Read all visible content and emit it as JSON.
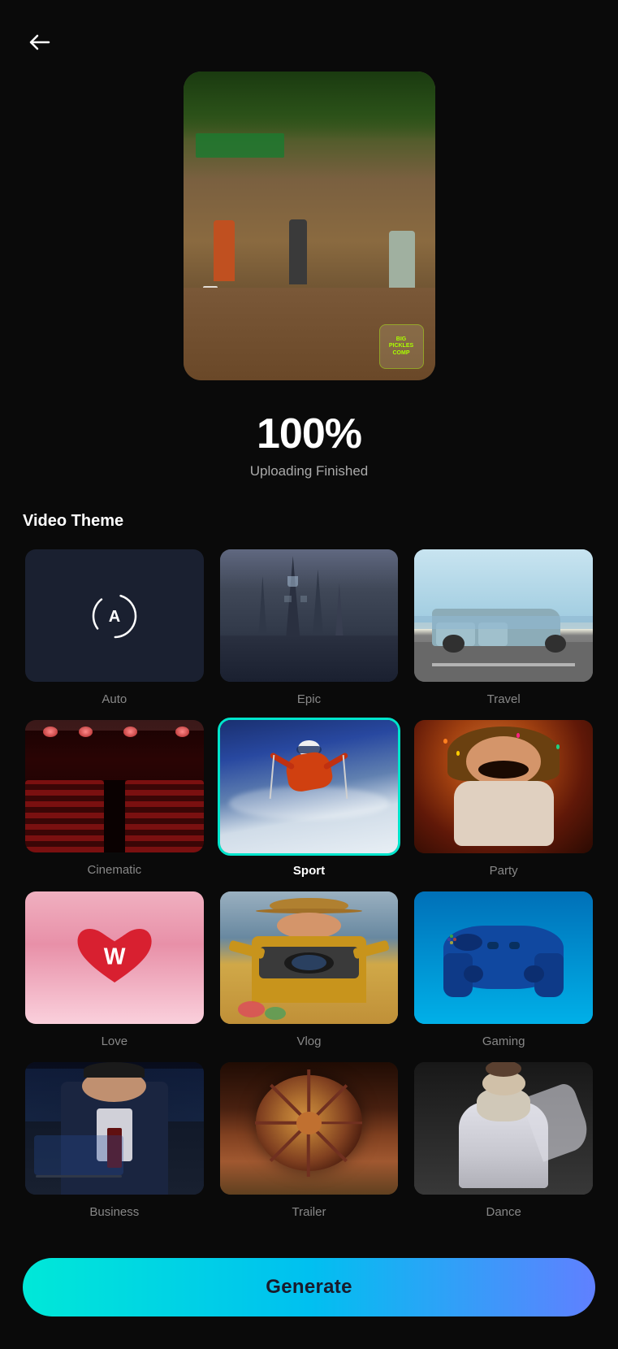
{
  "header": {
    "back_label": "←"
  },
  "upload": {
    "progress": "100%",
    "status": "Uploading Finished"
  },
  "theme_section": {
    "title": "Video Theme",
    "selected": "Sport",
    "themes": [
      {
        "id": "auto",
        "label": "Auto",
        "type": "auto"
      },
      {
        "id": "epic",
        "label": "Epic",
        "type": "epic"
      },
      {
        "id": "travel",
        "label": "Travel",
        "type": "travel"
      },
      {
        "id": "cinematic",
        "label": "Cinematic",
        "type": "cinematic"
      },
      {
        "id": "sport",
        "label": "Sport",
        "type": "sport",
        "selected": true
      },
      {
        "id": "party",
        "label": "Party",
        "type": "party"
      },
      {
        "id": "love",
        "label": "Love",
        "type": "love"
      },
      {
        "id": "vlog",
        "label": "Vlog",
        "type": "vlog"
      },
      {
        "id": "gaming",
        "label": "Gaming",
        "type": "gaming"
      },
      {
        "id": "business",
        "label": "Business",
        "type": "business"
      },
      {
        "id": "trailer",
        "label": "Trailer",
        "type": "trailer"
      },
      {
        "id": "dance",
        "label": "Dance",
        "type": "dance"
      }
    ]
  },
  "generate": {
    "button_label": "Generate"
  }
}
